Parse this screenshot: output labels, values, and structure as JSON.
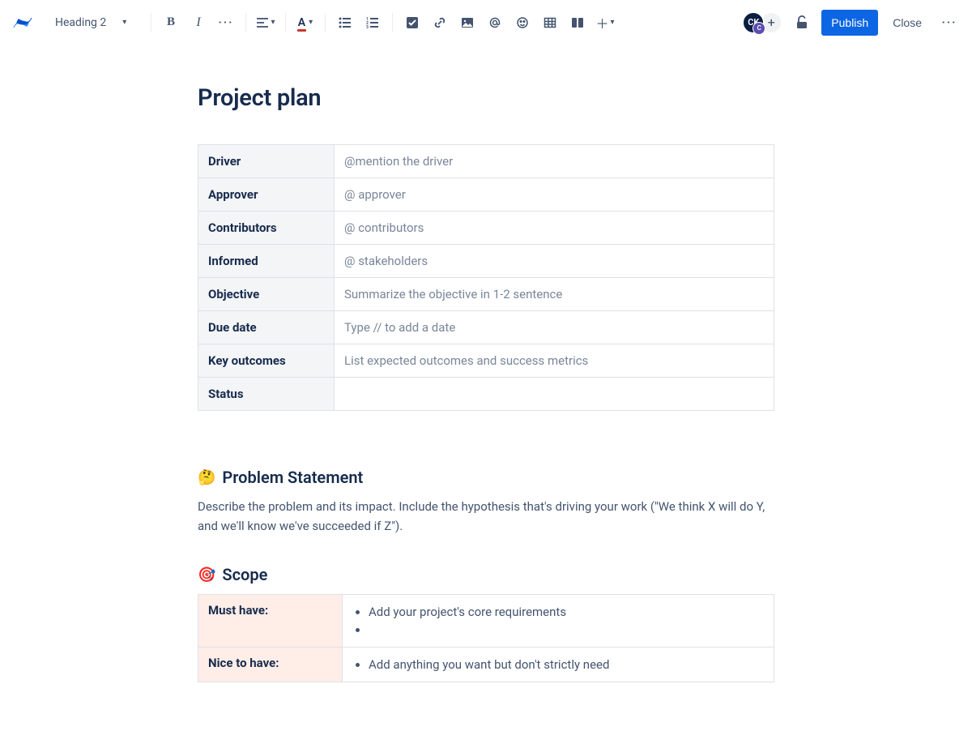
{
  "toolbar": {
    "heading_label": "Heading 2",
    "publish_label": "Publish",
    "close_label": "Close",
    "avatar_initials": "CK"
  },
  "page": {
    "title": "Project plan"
  },
  "meta_rows": [
    {
      "label": "Driver",
      "value": "@mention the driver"
    },
    {
      "label": "Approver",
      "value": "@ approver"
    },
    {
      "label": "Contributors",
      "value": "@ contributors"
    },
    {
      "label": "Informed",
      "value": "@ stakeholders"
    },
    {
      "label": "Objective",
      "value": "Summarize the objective in 1-2 sentence"
    },
    {
      "label": "Due date",
      "value": "Type // to add a date"
    },
    {
      "label": "Key outcomes",
      "value": "List expected outcomes and success metrics"
    },
    {
      "label": "Status",
      "value": ""
    }
  ],
  "sections": {
    "problem": {
      "emoji": "🤔",
      "title": "Problem Statement",
      "body": "Describe the problem and its impact. Include the hypothesis that's driving your work (\"We think X will do Y, and we'll know we've succeeded if Z\")."
    },
    "scope": {
      "emoji": "🎯",
      "title": "Scope",
      "rows": [
        {
          "label": "Must have:",
          "items": [
            "Add your project's core requirements",
            ""
          ]
        },
        {
          "label": "Nice to have:",
          "items": [
            "Add anything you want but don't strictly need"
          ]
        }
      ]
    }
  }
}
